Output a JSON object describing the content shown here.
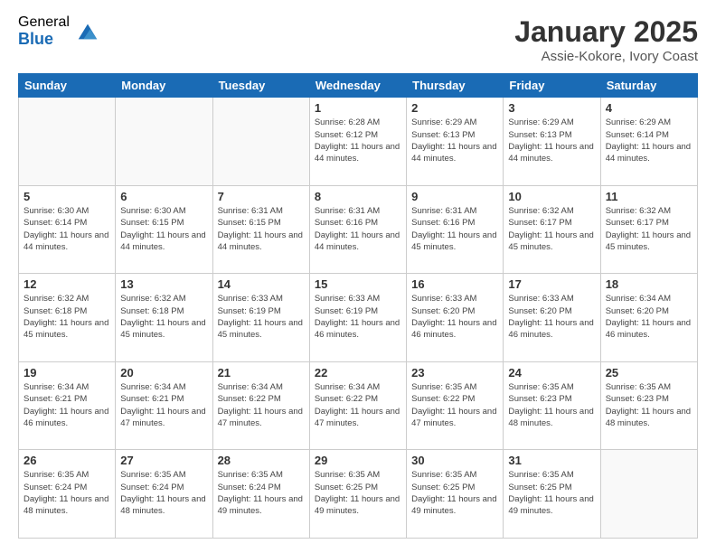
{
  "logo": {
    "general": "General",
    "blue": "Blue"
  },
  "header": {
    "title": "January 2025",
    "subtitle": "Assie-Kokore, Ivory Coast"
  },
  "weekdays": [
    "Sunday",
    "Monday",
    "Tuesday",
    "Wednesday",
    "Thursday",
    "Friday",
    "Saturday"
  ],
  "weeks": [
    [
      {
        "day": "",
        "info": ""
      },
      {
        "day": "",
        "info": ""
      },
      {
        "day": "",
        "info": ""
      },
      {
        "day": "1",
        "info": "Sunrise: 6:28 AM\nSunset: 6:12 PM\nDaylight: 11 hours and 44 minutes."
      },
      {
        "day": "2",
        "info": "Sunrise: 6:29 AM\nSunset: 6:13 PM\nDaylight: 11 hours and 44 minutes."
      },
      {
        "day": "3",
        "info": "Sunrise: 6:29 AM\nSunset: 6:13 PM\nDaylight: 11 hours and 44 minutes."
      },
      {
        "day": "4",
        "info": "Sunrise: 6:29 AM\nSunset: 6:14 PM\nDaylight: 11 hours and 44 minutes."
      }
    ],
    [
      {
        "day": "5",
        "info": "Sunrise: 6:30 AM\nSunset: 6:14 PM\nDaylight: 11 hours and 44 minutes."
      },
      {
        "day": "6",
        "info": "Sunrise: 6:30 AM\nSunset: 6:15 PM\nDaylight: 11 hours and 44 minutes."
      },
      {
        "day": "7",
        "info": "Sunrise: 6:31 AM\nSunset: 6:15 PM\nDaylight: 11 hours and 44 minutes."
      },
      {
        "day": "8",
        "info": "Sunrise: 6:31 AM\nSunset: 6:16 PM\nDaylight: 11 hours and 44 minutes."
      },
      {
        "day": "9",
        "info": "Sunrise: 6:31 AM\nSunset: 6:16 PM\nDaylight: 11 hours and 45 minutes."
      },
      {
        "day": "10",
        "info": "Sunrise: 6:32 AM\nSunset: 6:17 PM\nDaylight: 11 hours and 45 minutes."
      },
      {
        "day": "11",
        "info": "Sunrise: 6:32 AM\nSunset: 6:17 PM\nDaylight: 11 hours and 45 minutes."
      }
    ],
    [
      {
        "day": "12",
        "info": "Sunrise: 6:32 AM\nSunset: 6:18 PM\nDaylight: 11 hours and 45 minutes."
      },
      {
        "day": "13",
        "info": "Sunrise: 6:32 AM\nSunset: 6:18 PM\nDaylight: 11 hours and 45 minutes."
      },
      {
        "day": "14",
        "info": "Sunrise: 6:33 AM\nSunset: 6:19 PM\nDaylight: 11 hours and 45 minutes."
      },
      {
        "day": "15",
        "info": "Sunrise: 6:33 AM\nSunset: 6:19 PM\nDaylight: 11 hours and 46 minutes."
      },
      {
        "day": "16",
        "info": "Sunrise: 6:33 AM\nSunset: 6:20 PM\nDaylight: 11 hours and 46 minutes."
      },
      {
        "day": "17",
        "info": "Sunrise: 6:33 AM\nSunset: 6:20 PM\nDaylight: 11 hours and 46 minutes."
      },
      {
        "day": "18",
        "info": "Sunrise: 6:34 AM\nSunset: 6:20 PM\nDaylight: 11 hours and 46 minutes."
      }
    ],
    [
      {
        "day": "19",
        "info": "Sunrise: 6:34 AM\nSunset: 6:21 PM\nDaylight: 11 hours and 46 minutes."
      },
      {
        "day": "20",
        "info": "Sunrise: 6:34 AM\nSunset: 6:21 PM\nDaylight: 11 hours and 47 minutes."
      },
      {
        "day": "21",
        "info": "Sunrise: 6:34 AM\nSunset: 6:22 PM\nDaylight: 11 hours and 47 minutes."
      },
      {
        "day": "22",
        "info": "Sunrise: 6:34 AM\nSunset: 6:22 PM\nDaylight: 11 hours and 47 minutes."
      },
      {
        "day": "23",
        "info": "Sunrise: 6:35 AM\nSunset: 6:22 PM\nDaylight: 11 hours and 47 minutes."
      },
      {
        "day": "24",
        "info": "Sunrise: 6:35 AM\nSunset: 6:23 PM\nDaylight: 11 hours and 48 minutes."
      },
      {
        "day": "25",
        "info": "Sunrise: 6:35 AM\nSunset: 6:23 PM\nDaylight: 11 hours and 48 minutes."
      }
    ],
    [
      {
        "day": "26",
        "info": "Sunrise: 6:35 AM\nSunset: 6:24 PM\nDaylight: 11 hours and 48 minutes."
      },
      {
        "day": "27",
        "info": "Sunrise: 6:35 AM\nSunset: 6:24 PM\nDaylight: 11 hours and 48 minutes."
      },
      {
        "day": "28",
        "info": "Sunrise: 6:35 AM\nSunset: 6:24 PM\nDaylight: 11 hours and 49 minutes."
      },
      {
        "day": "29",
        "info": "Sunrise: 6:35 AM\nSunset: 6:25 PM\nDaylight: 11 hours and 49 minutes."
      },
      {
        "day": "30",
        "info": "Sunrise: 6:35 AM\nSunset: 6:25 PM\nDaylight: 11 hours and 49 minutes."
      },
      {
        "day": "31",
        "info": "Sunrise: 6:35 AM\nSunset: 6:25 PM\nDaylight: 11 hours and 49 minutes."
      },
      {
        "day": "",
        "info": ""
      }
    ]
  ]
}
